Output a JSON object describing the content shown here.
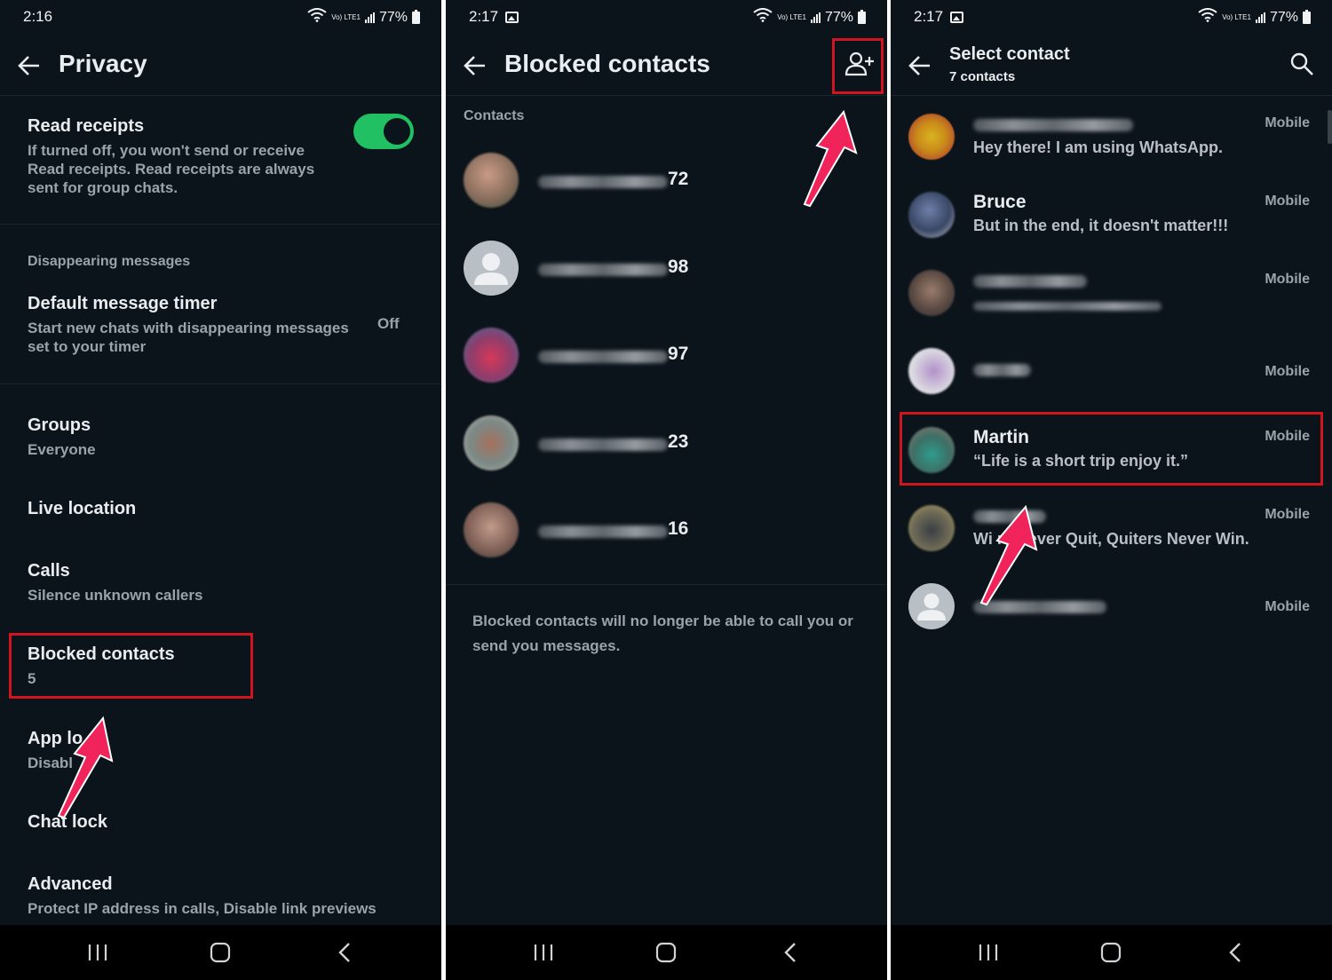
{
  "colors": {
    "background": "#0b141b",
    "accent_green": "#21c063",
    "highlight_red": "#d2141e",
    "arrow_pink": "#f0245a",
    "secondary_text": "#9aa3a9"
  },
  "panel1": {
    "status": {
      "time": "2:16",
      "battery": "77%",
      "net": "Vo) LTE1"
    },
    "title": "Privacy",
    "read_receipts": {
      "title": "Read receipts",
      "desc": "If turned off, you won't send or receive Read receipts. Read receipts are always sent for group chats.",
      "enabled": true
    },
    "section_disappearing": "Disappearing messages",
    "default_timer": {
      "title": "Default message timer",
      "desc": "Start new chats with disappearing messages set to your timer",
      "value": "Off"
    },
    "groups": {
      "title": "Groups",
      "sub": "Everyone"
    },
    "live_location": {
      "title": "Live location"
    },
    "calls": {
      "title": "Calls",
      "sub": "Silence unknown callers"
    },
    "blocked": {
      "title": "Blocked contacts",
      "sub": "5"
    },
    "app_lock": {
      "title": "App lo",
      "sub": "Disabl"
    },
    "chat_lock": {
      "title": "Chat lock"
    },
    "advanced": {
      "title": "Advanced",
      "sub": "Protect IP address in calls, Disable link previews"
    }
  },
  "panel2": {
    "status": {
      "time": "2:17",
      "battery": "77%",
      "net": "Vo) LTE1"
    },
    "title": "Blocked contacts",
    "section": "Contacts",
    "contacts": [
      {
        "suffix": "72",
        "avatar": "photo"
      },
      {
        "suffix": "98",
        "avatar": "default"
      },
      {
        "suffix": "97",
        "avatar": "photo"
      },
      {
        "suffix": "23",
        "avatar": "photo"
      },
      {
        "suffix": "16",
        "avatar": "photo"
      }
    ],
    "note": "Blocked contacts will no longer be able to call you or send you messages."
  },
  "panel3": {
    "status": {
      "time": "2:17",
      "battery": "77%",
      "net": "Vo) LTE1"
    },
    "title": "Select contact",
    "subtitle": "7 contacts",
    "contacts": [
      {
        "name": "",
        "about": "Hey there! I am using WhatsApp.",
        "kind": "Mobile"
      },
      {
        "name": "Bruce",
        "about": "But in the end, it doesn't matter!!!",
        "kind": "Mobile"
      },
      {
        "name": "",
        "about": "",
        "kind": "Mobile"
      },
      {
        "name": "",
        "about": "",
        "kind": "Mobile"
      },
      {
        "name": "Martin",
        "about": "“Life is a short trip enjoy it.”",
        "kind": "Mobile"
      },
      {
        "name": "",
        "about": "Wi     rs Never Quit, Quiters Never Win.",
        "kind": "Mobile"
      },
      {
        "name": "",
        "about": "",
        "kind": "Mobile"
      }
    ]
  }
}
